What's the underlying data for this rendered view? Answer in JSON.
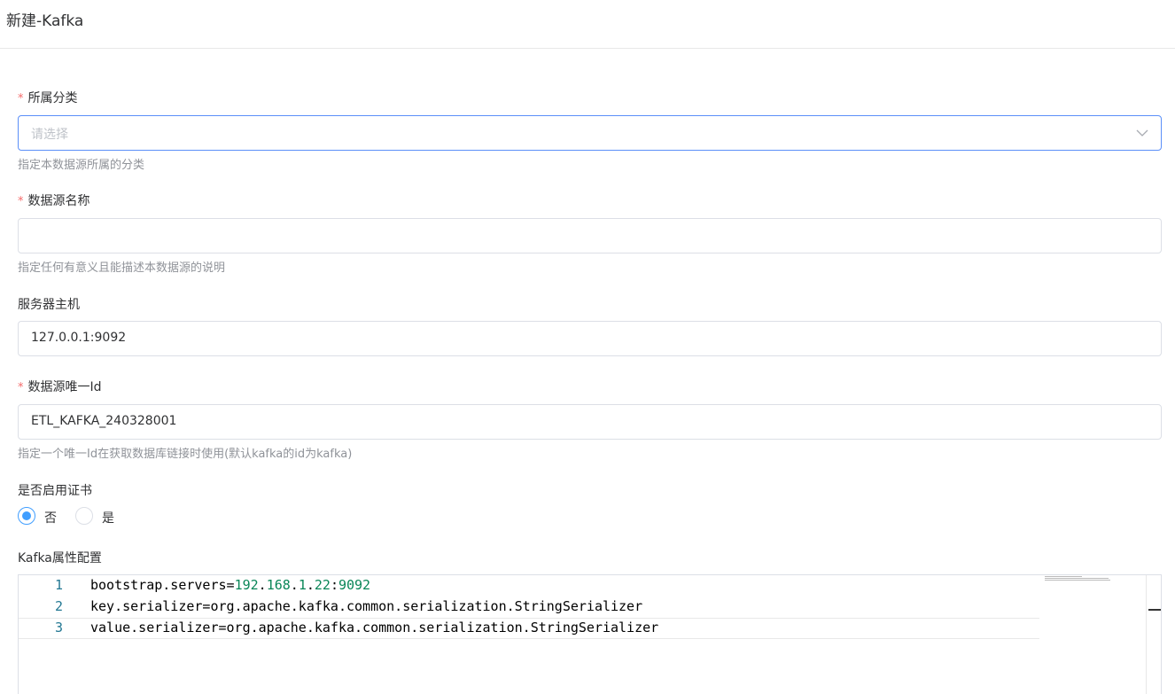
{
  "page": {
    "title": "新建-Kafka"
  },
  "form": {
    "category": {
      "required_mark": "*",
      "label": "所属分类",
      "placeholder": "请选择",
      "help": "指定本数据源所属的分类"
    },
    "datasource_name": {
      "required_mark": "*",
      "label": "数据源名称",
      "value": "",
      "help": "指定任何有意义且能描述本数据源的说明"
    },
    "server_host": {
      "label": "服务器主机",
      "value": "127.0.0.1:9092"
    },
    "datasource_id": {
      "required_mark": "*",
      "label": "数据源唯一Id",
      "value": "ETL_KAFKA_240328001",
      "help": "指定一个唯一Id在获取数据库链接时使用(默认kafka的id为kafka)"
    },
    "enable_cert": {
      "label": "是否启用证书",
      "options": [
        {
          "label": "否",
          "checked": true
        },
        {
          "label": "是",
          "checked": false
        }
      ]
    },
    "kafka_config": {
      "label": "Kafka属性配置",
      "lines": [
        {
          "num": "1",
          "key": "bootstrap.servers=",
          "value_parts": [
            "192",
            ".",
            "168",
            ".",
            "1",
            ".",
            "22",
            ":",
            "9092"
          ]
        },
        {
          "num": "2",
          "text": "key.serializer=org.apache.kafka.common.serialization.StringSerializer"
        },
        {
          "num": "3",
          "text": "value.serializer=org.apache.kafka.common.serialization.StringSerializer"
        }
      ]
    }
  },
  "colors": {
    "accent": "#409eff",
    "required": "#f56c6c",
    "help_text": "#909399",
    "line_number": "#237893",
    "number_token": "#098658"
  },
  "icons": {
    "select_arrow": "chevron-down-icon"
  }
}
